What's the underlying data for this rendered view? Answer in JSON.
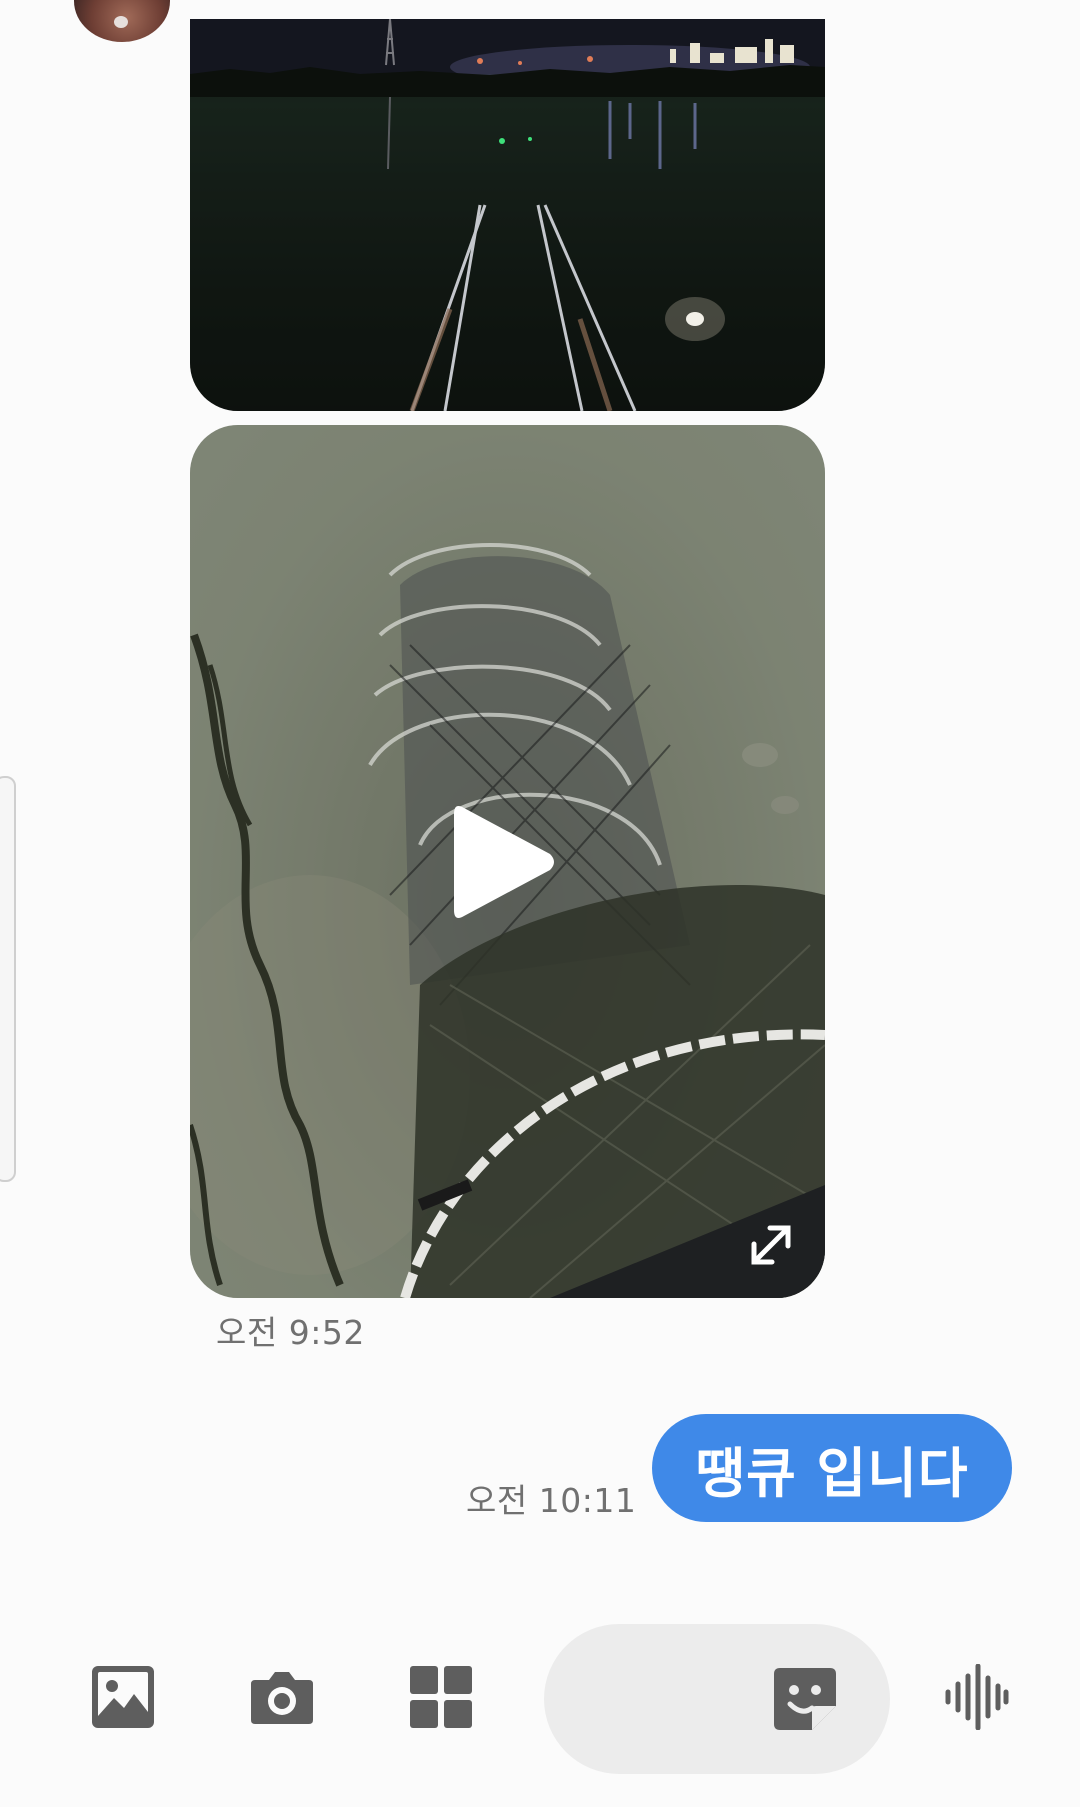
{
  "conversation": {
    "received_time": "오전 9:52",
    "sent_message": "땡큐 입니다",
    "sent_time": "오전 10:11"
  },
  "colors": {
    "sent_bubble": "#3f89e8",
    "background": "#fbfbfb",
    "compose_field": "#ececec",
    "toolbar_icon": "#5e5e5e",
    "timestamp_text": "#707070"
  },
  "icons": {
    "gallery": "image-icon",
    "camera": "camera-icon",
    "apps": "grid-icon",
    "sticker": "sticker-icon",
    "voice": "voice-waveform-icon",
    "play": "play-icon",
    "expand": "expand-icon"
  },
  "compose": {
    "value": "",
    "placeholder": ""
  }
}
